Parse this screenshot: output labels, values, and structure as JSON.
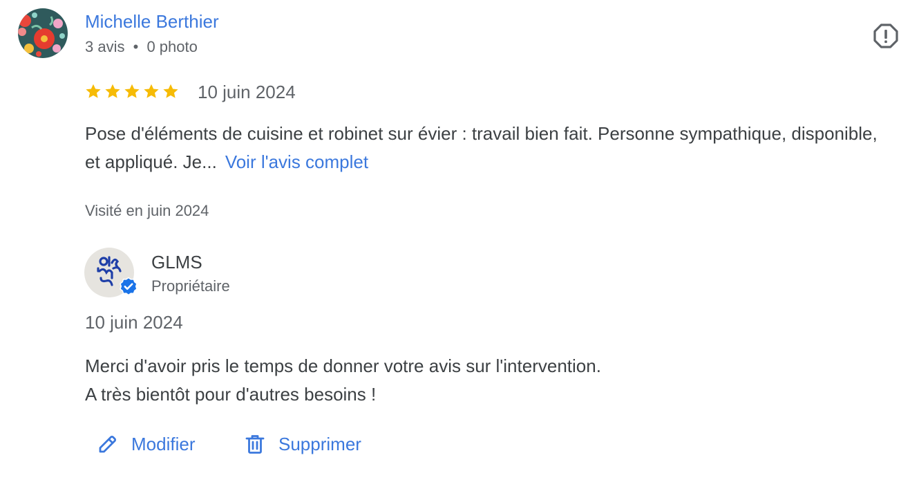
{
  "reviewer": {
    "name": "Michelle Berthier",
    "reviews_count": "3 avis",
    "separator": "•",
    "photos_count": "0 photo",
    "avatar_icon": "floral-avatar-icon"
  },
  "report": {
    "icon": "report-flag-icon"
  },
  "review": {
    "rating": 5,
    "rating_max": 5,
    "star_color": "#f6bb06",
    "date": "10 juin 2024",
    "text": "Pose d'éléments de cuisine et robinet sur évier : travail bien fait. Personne sympathique, disponible, et appliqué. Je...",
    "more_link": "Voir l'avis complet",
    "visited": "Visité en juin 2024"
  },
  "owner": {
    "name": "GLMS",
    "role": "Propriétaire",
    "logo_icon": "glms-logo-icon",
    "badge_icon": "verified-badge-icon",
    "badge_color": "#1a73e8",
    "response_date": "10 juin 2024",
    "response_lines": [
      "Merci d'avoir pris le temps de donner votre avis sur l'intervention.",
      "A très bientôt pour d'autres besoins !"
    ]
  },
  "actions": {
    "edit_label": "Modifier",
    "edit_icon": "pencil-icon",
    "delete_label": "Supprimer",
    "delete_icon": "trash-icon"
  },
  "colors": {
    "link": "#3b78dd",
    "text": "#3c4043",
    "secondary": "#5f6368"
  }
}
